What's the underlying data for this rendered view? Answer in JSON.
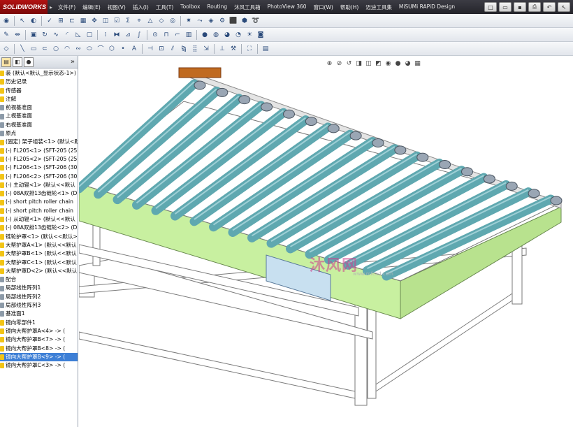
{
  "app": {
    "logo": "SOLIDWORKS"
  },
  "menu": {
    "items": [
      "文件(F)",
      "编辑(E)",
      "视图(V)",
      "插入(I)",
      "工具(T)",
      "Toolbox",
      "Routing",
      "沐风工具箱",
      "PhotoView 360",
      "窗口(W)",
      "帮助(H)",
      "迈迪工具集",
      "MiSUMi RAPiD Design"
    ]
  },
  "feature_tree": {
    "items": [
      {
        "label": "装 (默认<默认_显示状态-1>)",
        "icon": "assembly-icon"
      },
      {
        "label": "历史记录",
        "icon": "history-icon"
      },
      {
        "label": "传感器",
        "icon": "sensor-icon"
      },
      {
        "label": "注解",
        "icon": "annotation-icon"
      },
      {
        "label": "前视基准面",
        "icon": "plane-icon"
      },
      {
        "label": "上视基准面",
        "icon": "plane-icon"
      },
      {
        "label": "右视基准面",
        "icon": "plane-icon"
      },
      {
        "label": "原点",
        "icon": "origin-icon"
      },
      {
        "label": "(固定) 架子组装<1> (默认<默认",
        "icon": "part-icon"
      },
      {
        "label": "(-) FL205<1> (SFT-205 (25",
        "icon": "part-icon"
      },
      {
        "label": "(-) FL205<2> (SFT-205 (25",
        "icon": "part-icon"
      },
      {
        "label": "(-) FL206<1> (SFT-206 (30",
        "icon": "part-icon"
      },
      {
        "label": "(-) FL206<2> (SFT-206 (30",
        "icon": "part-icon"
      },
      {
        "label": "(-) 主动辊<1> (默认<<默认",
        "icon": "part-icon"
      },
      {
        "label": "(-) 08A双排13齿链轮<1> (D",
        "icon": "part-icon"
      },
      {
        "label": "(-) short pitch roller chain",
        "icon": "part-icon"
      },
      {
        "label": "(-) short pitch roller chain",
        "icon": "part-icon"
      },
      {
        "label": "(-) 从动辊<1> (默认<<默认",
        "icon": "part-icon"
      },
      {
        "label": "(-) 08A双排13齿链轮<2> (D",
        "icon": "part-icon"
      },
      {
        "label": "链轮护罩<1> (默认<<默认>",
        "icon": "part-icon"
      },
      {
        "label": "大帮护罩A<1> (默认<<默认",
        "icon": "part-icon"
      },
      {
        "label": "大帮护罩B<1> (默认<<默认",
        "icon": "part-icon"
      },
      {
        "label": "大帮护罩C<1> (默认<<默认",
        "icon": "part-icon"
      },
      {
        "label": "大帮护罩D<2> (默认<<默认",
        "icon": "part-icon"
      },
      {
        "label": "配合",
        "icon": "mate-icon"
      },
      {
        "label": "局部线性阵列1",
        "icon": "pattern-icon"
      },
      {
        "label": "局部线性阵列2",
        "icon": "pattern-icon"
      },
      {
        "label": "局部线性阵列3",
        "icon": "pattern-icon"
      },
      {
        "label": "基准面1",
        "icon": "plane-icon"
      },
      {
        "label": "镜向零部件1",
        "icon": "mirror-icon"
      },
      {
        "label": "镜向大帮护罩A<4> -> (",
        "icon": "mirror-part-icon"
      },
      {
        "label": "镜向大帮护罩B<7> -> (",
        "icon": "mirror-part-icon"
      },
      {
        "label": "镜向大帮护罩B<8> -> (",
        "icon": "mirror-part-icon"
      },
      {
        "label": "镜向大帮护罩B<9> -> (",
        "icon": "mirror-part-icon",
        "selected": true
      },
      {
        "label": "镜向大帮护罩C<3> -> (",
        "icon": "mirror-part-icon"
      }
    ]
  },
  "panel": {
    "collapse_glyph": "»"
  },
  "watermark": {
    "text": "沐风网",
    "sub": "www.mfcad.com"
  },
  "colors": {
    "roller": "#5fa8b0",
    "frame_green": "#c8f0a0",
    "legs": "#ffffff",
    "accent": "#c0392b"
  }
}
